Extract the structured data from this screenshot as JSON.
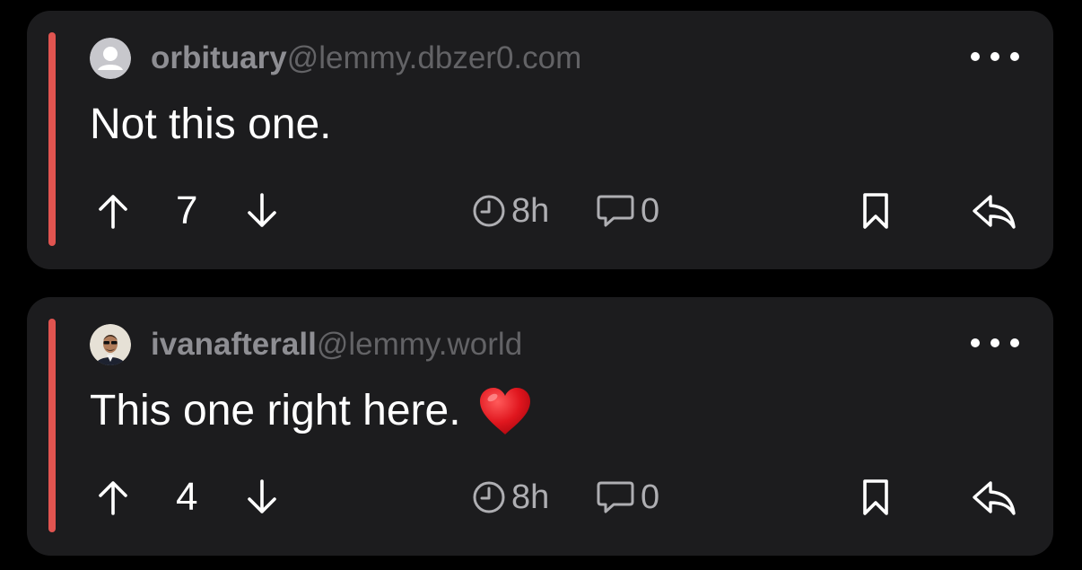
{
  "comments": [
    {
      "username": "orbituary",
      "instance": "@lemmy.dbzer0.com",
      "avatar": "default-avatar-icon",
      "body": "Not this one.",
      "emoji": "",
      "score": "7",
      "age": "8h",
      "reply_count": "0"
    },
    {
      "username": "ivanafterall",
      "instance": "@lemmy.world",
      "avatar": "user-photo-avatar",
      "body": "This one right here.",
      "emoji": "❤️",
      "score": "4",
      "age": "8h",
      "reply_count": "0"
    }
  ],
  "icons": {
    "upvote": "arrow-up-icon",
    "downvote": "arrow-down-icon",
    "time": "clock-icon",
    "comments": "speech-bubble-icon",
    "bookmark": "bookmark-icon",
    "reply": "reply-arrow-icon",
    "more": "ellipsis-icon"
  },
  "colors": {
    "background": "#000000",
    "card": "#1c1c1e",
    "accent_bar": "#e05450",
    "username": "#8e8e93",
    "instance": "#636366",
    "text": "#ffffff",
    "meta": "#aeaeb2"
  }
}
